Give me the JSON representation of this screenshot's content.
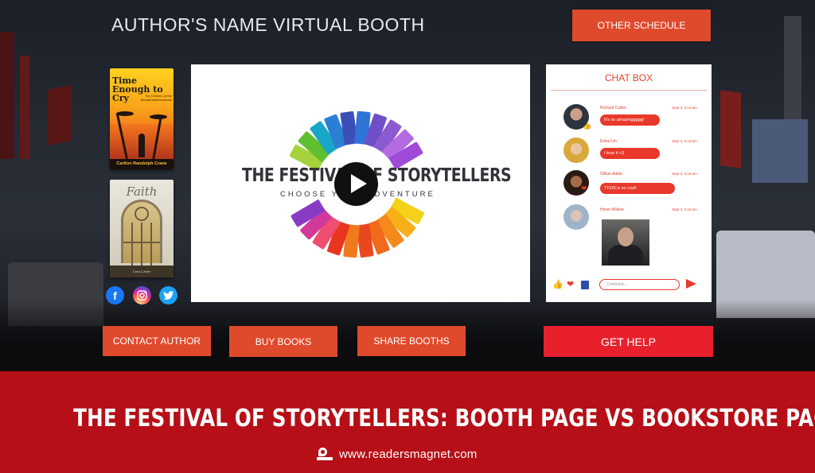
{
  "header": {
    "title": "AUTHOR'S NAME VIRTUAL BOOTH",
    "other_schedule": "OTHER SCHEDULE"
  },
  "books": [
    {
      "title": "Time Enough to Cry",
      "subtitle": "The Children of the WonderfullAdventures",
      "author": "Carlton Randolph Crane"
    },
    {
      "title": "Faith",
      "author": "Carla Cahier"
    }
  ],
  "social": {
    "facebook": "f",
    "instagram": "instagram-icon",
    "twitter": "twitter-icon"
  },
  "video": {
    "logo_title": "THE FESTIVAL OF STORYTELLERS",
    "logo_tagline": "CHOOSE YOUR ADVENTURE",
    "play_icon": "play-icon"
  },
  "chat": {
    "title": "CHAT BOX",
    "messages": [
      {
        "sender": "Richard Cullen",
        "time": "Sept 4, 3:14 am",
        "text": "It's so amazinggggg!"
      },
      {
        "sender": "Erika Lim",
        "time": "Sept 4, 3:14 am",
        "text": "I love it <3"
      },
      {
        "sender": "Gillian Adala",
        "time": "Sept 4, 3:16 am",
        "text": "TFOS is so cool!"
      },
      {
        "sender": "Hover Walker",
        "time": "Sept 4, 3:16 am",
        "text": ""
      }
    ],
    "comment_placeholder": "Comment...",
    "reactions": [
      "thumbs-up-icon",
      "heart-icon",
      "book-icon"
    ]
  },
  "actions": {
    "contact_author": "CONTACT AUTHOR",
    "buy_books": "BUY BOOKS",
    "share_booths": "SHARE BOOTHS",
    "get_help": "GET HELP"
  },
  "banner": {
    "title": "THE FESTIVAL OF STORYTELLERS: BOOTH PAGE VS BOOKSTORE PAGE",
    "url": "www.readersmagnet.com"
  },
  "colors": {
    "accent": "#e04a2c",
    "help": "#e8202c",
    "banner": "#b60f17",
    "chat_red": "#e9392a"
  }
}
